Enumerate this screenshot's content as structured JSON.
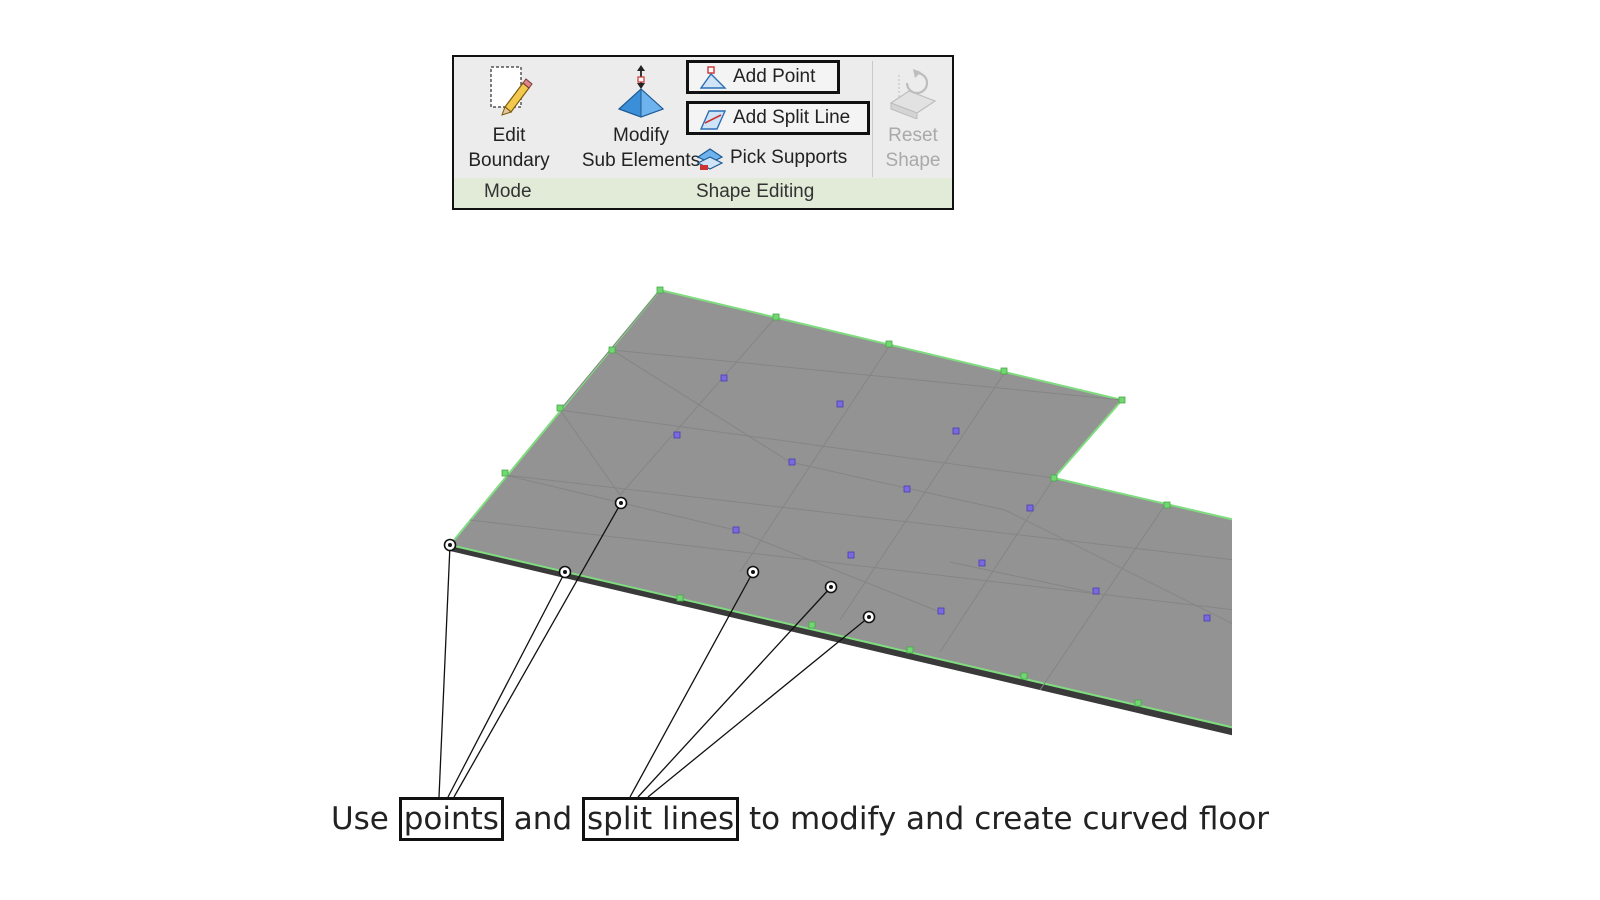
{
  "ribbon": {
    "tools": {
      "edit_boundary": {
        "line1": "Edit",
        "line2": "Boundary",
        "icon": "edit-boundary-icon"
      },
      "modify_sub_elements": {
        "line1": "Modify",
        "line2": "Sub Elements",
        "icon": "modify-sub-elements-icon"
      },
      "add_point": {
        "label": "Add Point",
        "icon": "add-point-icon",
        "highlighted": true
      },
      "add_split_line": {
        "label": "Add Split Line",
        "icon": "add-split-line-icon",
        "highlighted": true
      },
      "pick_supports": {
        "label": "Pick Supports",
        "icon": "pick-supports-icon"
      },
      "reset_shape": {
        "line1": "Reset",
        "line2": "Shape",
        "icon": "reset-shape-icon",
        "enabled": false
      }
    },
    "panels": {
      "mode": "Mode",
      "shape_editing": "Shape Editing"
    }
  },
  "viewport": {
    "floor_color": "#939393",
    "edge_point_color": "#6fd96f",
    "interior_point_color": "#7a6ae0"
  },
  "caption": {
    "pre": "Use",
    "word1": "points",
    "mid": "and",
    "word2": "split lines",
    "post": "to modify and create curved floor"
  }
}
